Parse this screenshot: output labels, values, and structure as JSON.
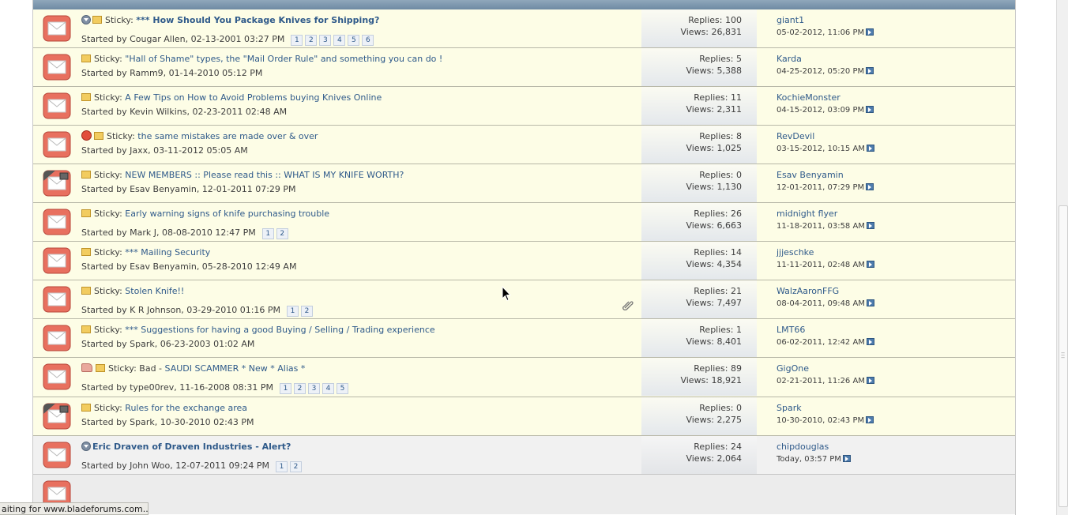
{
  "threads": [
    {
      "prefix": "Sticky:",
      "title": "*** How Should You Package Knives for Shipping?",
      "started": "Started by Cougar Allen, 02-13-2001 03:27 PM",
      "pages": [
        "1",
        "2",
        "3",
        "4",
        "5",
        "6"
      ],
      "replies": "Replies: 100",
      "views": "Views: 26,831",
      "last_user": "giant1",
      "last_date": "05-02-2012, 11:06 PM"
    },
    {
      "prefix": "Sticky:",
      "title": "\"Hall of Shame\" types, the \"Mail Order Rule\" and something you can do !",
      "started": "Started by Ramm9, 01-14-2010 05:12 PM",
      "pages": [],
      "replies": "Replies: 5",
      "views": "Views: 5,388",
      "last_user": "Karda",
      "last_date": "04-25-2012, 05:20 PM"
    },
    {
      "prefix": "Sticky:",
      "title": "A Few Tips on How to Avoid Problems buying Knives Online",
      "started": "Started by Kevin Wilkins, 02-23-2011 02:48 AM",
      "pages": [],
      "replies": "Replies: 11",
      "views": "Views: 2,311",
      "last_user": "KochieMonster",
      "last_date": "04-15-2012, 03:09 PM"
    },
    {
      "prefix": "Sticky:",
      "title": "the same mistakes are made over & over",
      "started": "Started by Jaxx, 03-11-2012 05:05 AM",
      "pages": [],
      "replies": "Replies: 8",
      "views": "Views: 1,025",
      "last_user": "RevDevil",
      "last_date": "03-15-2012, 10:15 AM"
    },
    {
      "prefix": "Sticky:",
      "title": "NEW MEMBERS :: Please read this :: WHAT IS MY KNIFE WORTH?",
      "started": "Started by Esav Benyamin, 12-01-2011 07:29 PM",
      "pages": [],
      "replies": "Replies: 0",
      "views": "Views: 1,130",
      "last_user": "Esav Benyamin",
      "last_date": "12-01-2011, 07:29 PM"
    },
    {
      "prefix": "Sticky:",
      "title": "Early warning signs of knife purchasing trouble",
      "started": "Started by Mark J, 08-08-2010 12:47 PM",
      "pages": [
        "1",
        "2"
      ],
      "replies": "Replies: 26",
      "views": "Views: 6,663",
      "last_user": "midnight flyer",
      "last_date": "11-18-2011, 03:58 AM"
    },
    {
      "prefix": "Sticky:",
      "title": "*** Mailing Security",
      "started": "Started by Esav Benyamin, 05-28-2010 12:49 AM",
      "pages": [],
      "replies": "Replies: 14",
      "views": "Views: 4,354",
      "last_user": "jjjeschke",
      "last_date": "11-11-2011, 02:48 AM"
    },
    {
      "prefix": "Sticky:",
      "title": "Stolen Knife!!",
      "started": "Started by K R Johnson, 03-29-2010 01:16 PM",
      "pages": [
        "1",
        "2"
      ],
      "replies": "Replies: 21",
      "views": "Views: 7,497",
      "last_user": "WalzAaronFFG",
      "last_date": "08-04-2011, 09:48 AM"
    },
    {
      "prefix": "Sticky:",
      "title": "*** Suggestions for having a good Buying / Selling / Trading experience",
      "started": "Started by Spark, 06-23-2003 01:02 AM",
      "pages": [],
      "replies": "Replies: 1",
      "views": "Views: 8,401",
      "last_user": "LMT66",
      "last_date": "06-02-2011, 12:42 AM"
    },
    {
      "prefix": "Sticky: Bad -",
      "title": "SAUDI SCAMMER * New * Alias *",
      "started": "Started by type00rev, 11-16-2008 08:31 PM",
      "pages": [
        "1",
        "2",
        "3",
        "4",
        "5"
      ],
      "replies": "Replies: 89",
      "views": "Views: 18,921",
      "last_user": "GigOne",
      "last_date": "02-21-2011, 11:26 AM"
    },
    {
      "prefix": "Sticky:",
      "title": "Rules for the exchange area",
      "started": "Started by Spark, 10-30-2010 02:43 PM",
      "pages": [],
      "replies": "Replies: 0",
      "views": "Views: 2,275",
      "last_user": "Spark",
      "last_date": "10-30-2010, 02:43 PM"
    },
    {
      "prefix": "",
      "title": "Eric Draven of Draven Industries - Alert?",
      "started": "Started by John Woo, 12-07-2011 09:24 PM",
      "pages": [
        "1",
        "2"
      ],
      "replies": "Replies: 24",
      "views": "Views: 2,064",
      "last_user": "chipdouglas",
      "last_date": "Today, 03:57 PM"
    }
  ],
  "status_bar": "aiting for www.bladeforums.com...",
  "colors": {
    "sticky_row": "#fdfde6",
    "normal_row": "#f1f1f1",
    "link": "#2f5a8a",
    "header": "#7b95ac"
  }
}
